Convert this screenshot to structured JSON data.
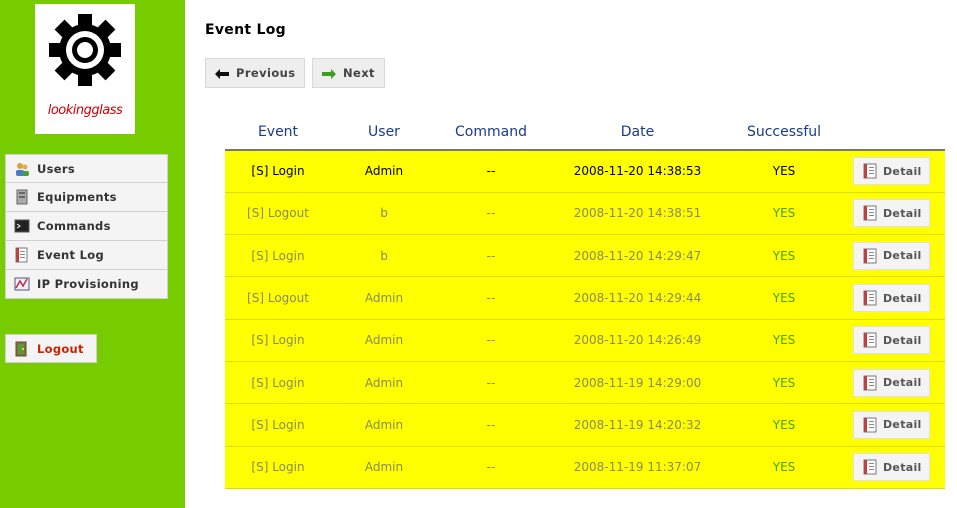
{
  "logo": {
    "text": "lookingglass"
  },
  "sidebar": {
    "items": [
      {
        "label": "Users",
        "icon": "users-icon"
      },
      {
        "label": "Equipments",
        "icon": "server-icon"
      },
      {
        "label": "Commands",
        "icon": "terminal-icon"
      },
      {
        "label": "Event Log",
        "icon": "log-icon"
      },
      {
        "label": "IP Provisioning",
        "icon": "network-icon"
      }
    ],
    "logout_label": "Logout"
  },
  "main": {
    "title": "Event Log",
    "prev_label": "Previous",
    "next_label": "Next",
    "columns": [
      "Event",
      "User",
      "Command",
      "Date",
      "Successful",
      ""
    ],
    "detail_label": "Detail",
    "rows": [
      {
        "event": "[S] Login",
        "user": "Admin",
        "command": "--",
        "date": "2008-11-20 14:38:53",
        "successful": "YES"
      },
      {
        "event": "[S] Logout",
        "user": "b",
        "command": "--",
        "date": "2008-11-20 14:38:51",
        "successful": "YES"
      },
      {
        "event": "[S] Login",
        "user": "b",
        "command": "--",
        "date": "2008-11-20 14:29:47",
        "successful": "YES"
      },
      {
        "event": "[S] Logout",
        "user": "Admin",
        "command": "--",
        "date": "2008-11-20 14:29:44",
        "successful": "YES"
      },
      {
        "event": "[S] Login",
        "user": "Admin",
        "command": "--",
        "date": "2008-11-20 14:26:49",
        "successful": "YES"
      },
      {
        "event": "[S] Login",
        "user": "Admin",
        "command": "--",
        "date": "2008-11-19 14:29:00",
        "successful": "YES"
      },
      {
        "event": "[S] Login",
        "user": "Admin",
        "command": "--",
        "date": "2008-11-19 14:20:32",
        "successful": "YES"
      },
      {
        "event": "[S] Login",
        "user": "Admin",
        "command": "--",
        "date": "2008-11-19 11:37:07",
        "successful": "YES"
      }
    ]
  },
  "colors": {
    "sidebar_bg": "#77cc00",
    "row_bg": "#ffff00",
    "header_text": "#1a3a8a",
    "success_text": "#4aa000",
    "logout_text": "#cc2200"
  }
}
